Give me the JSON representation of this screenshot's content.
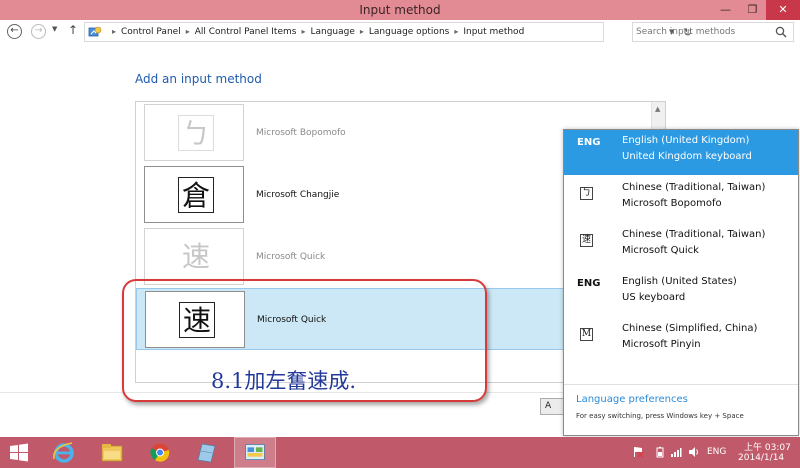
{
  "window": {
    "title": "Input method",
    "minimize": "—",
    "maximize": "❐",
    "close": "✕"
  },
  "nav": {
    "breadcrumb": [
      "Control Panel",
      "All Control Panel Items",
      "Language",
      "Language options",
      "Input method"
    ],
    "search_placeholder": "Search input methods"
  },
  "main": {
    "title": "Add an input method",
    "items": [
      {
        "label": "Microsoft Bopomofo",
        "glyph": "ㄅ"
      },
      {
        "label": "Microsoft Changjie",
        "glyph": "倉"
      },
      {
        "label": "Microsoft Quick",
        "glyph": "速"
      },
      {
        "label": "Microsoft Quick",
        "glyph": "速"
      }
    ],
    "cancel_partial": "A"
  },
  "annotation": {
    "text": "8.1加左奮速成."
  },
  "flyout": {
    "languages": [
      {
        "code": "ENG",
        "name": "English (United Kingdom)",
        "keyboard": "United Kingdom keyboard"
      },
      {
        "glyph": "ㄅ",
        "name": "Chinese (Traditional, Taiwan)",
        "keyboard": "Microsoft Bopomofo"
      },
      {
        "glyph": "速",
        "name": "Chinese (Traditional, Taiwan)",
        "keyboard": "Microsoft Quick"
      },
      {
        "code": "ENG",
        "name": "English (United States)",
        "keyboard": "US keyboard"
      },
      {
        "glyph": "M",
        "name": "Chinese (Simplified, China)",
        "keyboard": "Microsoft Pinyin"
      }
    ],
    "preferences_link": "Language preferences",
    "hint": "For easy switching, press Windows key + Space"
  },
  "taskbar": {
    "ime_indicator": "ENG",
    "time": "上午 03:07",
    "date": "2014/1/14"
  },
  "colors": {
    "titlebar": "#e38b94",
    "taskbar": "#c05a6b",
    "selection": "#2b9ae3",
    "link": "#1e5bb0",
    "annotation_border": "#d73a3a",
    "annotation_text": "#22399a"
  }
}
